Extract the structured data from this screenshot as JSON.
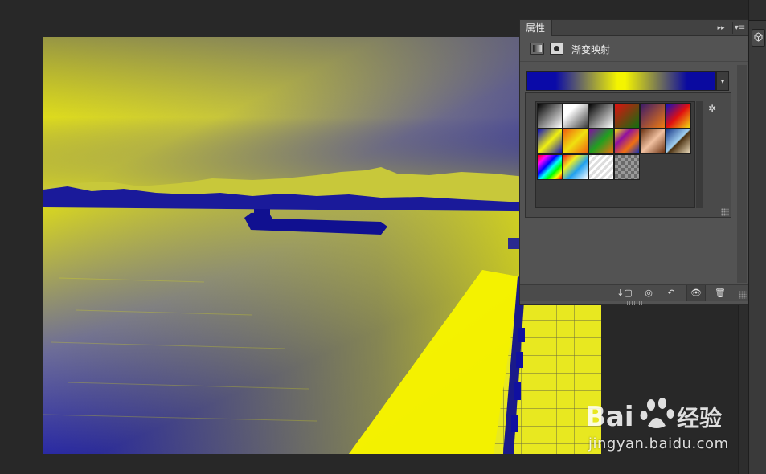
{
  "panel": {
    "tab_label": "属性",
    "collapse_glyph": "▸▸",
    "menu_glyph": "▾≡",
    "adjustment_title": "渐变映射",
    "dropdown_glyph": "▾",
    "gear_glyph": "✲",
    "footer": {
      "clip_label": "↓▢",
      "prev_state_label": "◎",
      "reset_label": "↶",
      "visibility_label": "👁",
      "delete_label": "🗑"
    }
  },
  "gradient": {
    "colors": [
      "#0a0aa8",
      "#f4f400",
      "#0a0aa0"
    ]
  },
  "presets": [
    {
      "name": "foreground-background",
      "css": "linear-gradient(135deg,#000 0%,#fff 100%)"
    },
    {
      "name": "foreground-transparent",
      "css": "linear-gradient(135deg,#fff 0%,#fff 30%,transparent 100%)"
    },
    {
      "name": "black-white",
      "css": "linear-gradient(135deg,#000 0%,#fff 100%)"
    },
    {
      "name": "red-green",
      "css": "linear-gradient(135deg,#e01010 0%,#107010 100%)"
    },
    {
      "name": "violet-orange",
      "css": "linear-gradient(135deg,#3a1a6a 0%,#f07a10 100%)"
    },
    {
      "name": "blue-red-yellow",
      "css": "linear-gradient(135deg,#1010c0 0%,#e01010 50%,#f0e010 100%)"
    },
    {
      "name": "blue-yellow-blue",
      "css": "linear-gradient(135deg,#1010c0 0%,#f0f010 50%,#1010c0 100%)"
    },
    {
      "name": "orange-yellow-orange",
      "css": "linear-gradient(135deg,#f06010 0%,#f0e010 50%,#f06010 100%)"
    },
    {
      "name": "violet-green-orange",
      "css": "linear-gradient(135deg,#8010a0 0%,#20a020 50%,#f07010 100%)"
    },
    {
      "name": "yellow-violet-orange-blue",
      "css": "linear-gradient(135deg,#f0e010 0%,#9010a0 33%,#f07010 66%,#1030c0 100%)"
    },
    {
      "name": "copper",
      "css": "linear-gradient(135deg,#6a3010 0%,#f0c0a0 50%,#6a3010 100%)"
    },
    {
      "name": "chrome",
      "css": "linear-gradient(135deg,#1a3a8a 0%,#a0d0f0 48%,#4a3010 52%,#f0e0c0 100%)"
    },
    {
      "name": "spectrum",
      "css": "linear-gradient(135deg,#f00 0%,#f0f 20%,#00f 40%,#0ff 55%,#0f0 70%,#ff0 85%,#f00 100%)"
    },
    {
      "name": "transparent-rainbow",
      "css": "linear-gradient(135deg,#f02020 0%,#f0f020 30%,#20a0f0 60%,#fff 100%)"
    },
    {
      "name": "transparent-stripes",
      "css": "repeating-linear-gradient(135deg,#ddd 0 3px,#fff 3px 6px)"
    },
    {
      "name": "checker-transparent",
      "css": "repeating-conic-gradient(#9a9a9a 0 25%, #6a6a6a 0 50%) 0 0/8px 8px"
    }
  ],
  "watermark": {
    "brand": "Bai",
    "brand_cn": "经验",
    "url": "jingyan.baidu.com"
  }
}
